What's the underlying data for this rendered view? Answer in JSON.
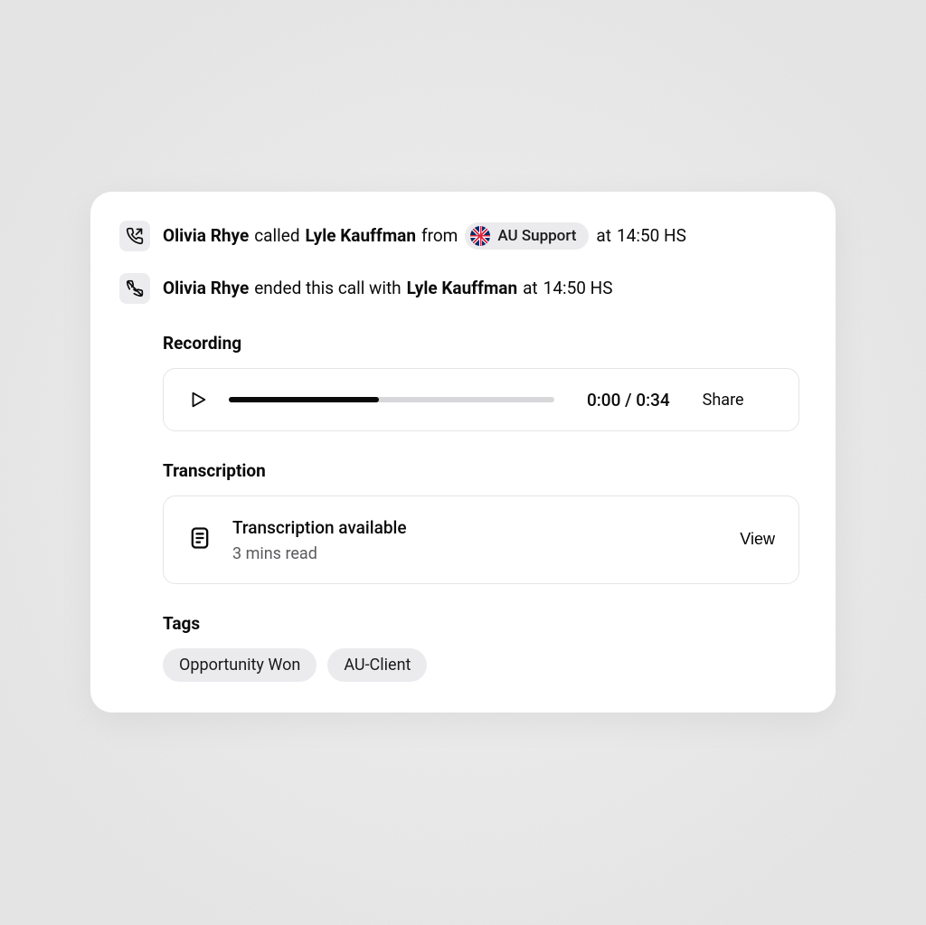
{
  "events": {
    "started": {
      "caller": "Olivia Rhye",
      "verb": "called",
      "callee": "Lyle Kauffman",
      "from_word": "from",
      "team_label": "AU Support",
      "at_word": "at",
      "time": "14:50 HS"
    },
    "ended": {
      "caller": "Olivia Rhye",
      "verb": "ended this call with",
      "callee": "Lyle Kauffman",
      "at_word": "at",
      "time": "14:50 HS"
    }
  },
  "recording": {
    "heading": "Recording",
    "current": "0:00",
    "sep": " / ",
    "total": "0:34",
    "share": "Share"
  },
  "transcription": {
    "heading": "Transcription",
    "title": "Transcription available",
    "sub": "3 mins read",
    "view": "View"
  },
  "tags": {
    "heading": "Tags",
    "items": [
      "Opportunity Won",
      "AU-Client"
    ]
  }
}
